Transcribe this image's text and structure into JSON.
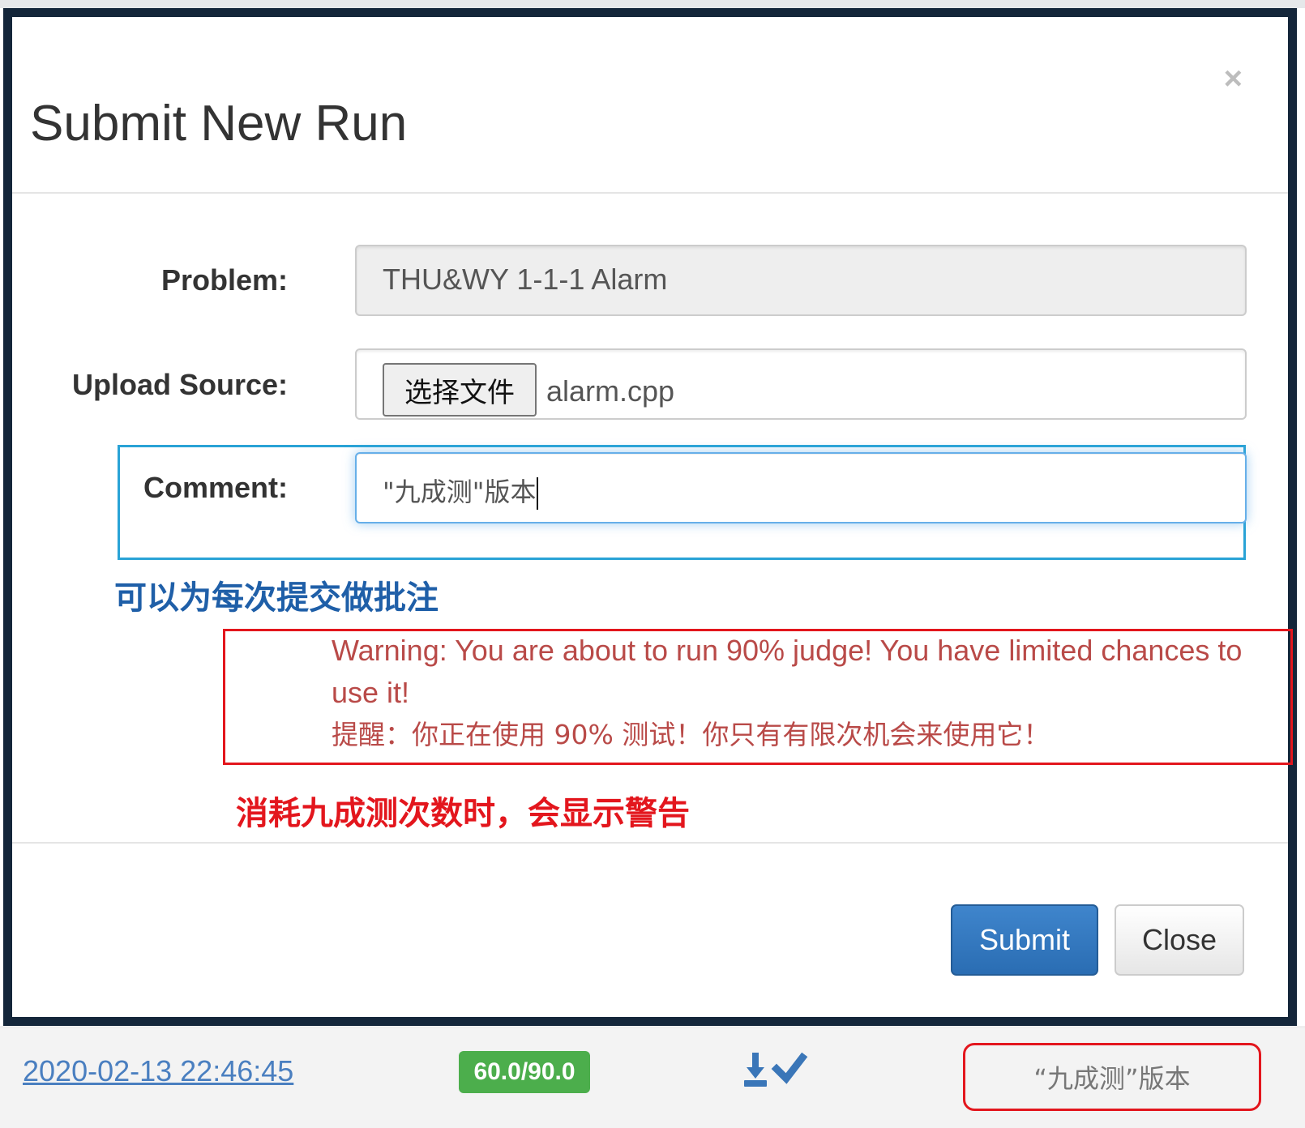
{
  "modal": {
    "title": "Submit New Run",
    "close_symbol": "×",
    "problem": {
      "label": "Problem:",
      "value": "THU&WY 1-1-1 Alarm"
    },
    "upload": {
      "label": "Upload Source:",
      "button_label": "选择文件",
      "file_name": "alarm.cpp"
    },
    "comment": {
      "label": "Comment:",
      "value": "\"九成测\"版本"
    },
    "annotation_comment": "可以为每次提交做批注",
    "warning": {
      "en": "Warning: You are about to run 90% judge! You have limited chances to use it!",
      "cn": "提醒：你正在使用 90% 测试！你只有有限次机会来使用它！"
    },
    "annotation_warning": "消耗九成测次数时，会显示警告",
    "buttons": {
      "submit": "Submit",
      "close": "Close"
    }
  },
  "run_row": {
    "date": "2020-02-13 22:46:45",
    "score": "60.0/90.0",
    "icons": [
      "download-icon",
      "check-icon"
    ],
    "comment": "“九成测”版本"
  },
  "colors": {
    "modal_border": "#14263a",
    "primary": "#2a6db3",
    "warning_text": "#b94a48",
    "annotation_red": "#e3161d",
    "annotation_blue": "#1f5fa8",
    "success_badge": "#4cae4c"
  }
}
